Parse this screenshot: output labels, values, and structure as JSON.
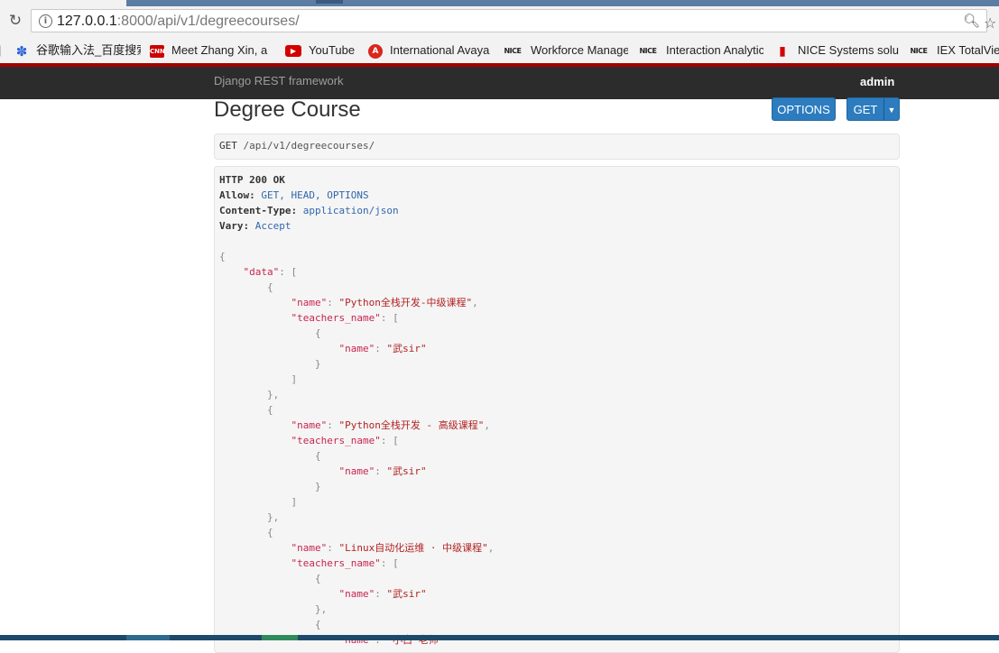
{
  "browser": {
    "url_host": "127.0.0.1",
    "url_path": ":8000/api/v1/degreecourses/",
    "bookmarks": [
      {
        "label": "谷歌输入法_百度搜索",
        "icon": "baidu-paw-icon"
      },
      {
        "label": "Meet Zhang Xin, a",
        "icon": "cnn-icon"
      },
      {
        "label": "YouTube",
        "icon": "youtube-icon"
      },
      {
        "label": "International Avaya",
        "icon": "avaya-icon"
      },
      {
        "label": "Workforce Manage",
        "icon": "nice-icon"
      },
      {
        "label": "Interaction Analytic",
        "icon": "nice-icon"
      },
      {
        "label": "NICE Systems solu",
        "icon": "flag-icon"
      },
      {
        "label": "IEX TotalView",
        "icon": "nice-icon"
      }
    ],
    "icon_text": {
      "cnn": "CNN",
      "youtube": "▶",
      "avaya": "A",
      "nice": "NICE",
      "flag": "▮"
    }
  },
  "navbar": {
    "brand": "Django REST framework",
    "user": "admin"
  },
  "page": {
    "title": "Degree Course",
    "options_label": "OPTIONS",
    "get_label": "GET",
    "request_method": "GET",
    "request_path": "/api/v1/degreecourses/"
  },
  "response": {
    "status_line": "HTTP 200 OK",
    "headers": [
      {
        "key": "Allow:",
        "value": "GET, HEAD, OPTIONS"
      },
      {
        "key": "Content-Type:",
        "value": "application/json"
      },
      {
        "key": "Vary:",
        "value": "Accept"
      }
    ],
    "body": {
      "data_key": "\"data\"",
      "name_key": "\"name\"",
      "teachers_key": "\"teachers_name\"",
      "courses": [
        {
          "name": "\"Python全栈开发-中级课程\"",
          "teachers": [
            "\"武sir\""
          ]
        },
        {
          "name": "\"Python全栈开发 - 高级课程\"",
          "teachers": [
            "\"武sir\""
          ]
        },
        {
          "name": "\"Linux自动化运维 · 中级课程\"",
          "teachers": [
            "\"武sir\"",
            "\"小白·老师\""
          ]
        }
      ]
    }
  }
}
